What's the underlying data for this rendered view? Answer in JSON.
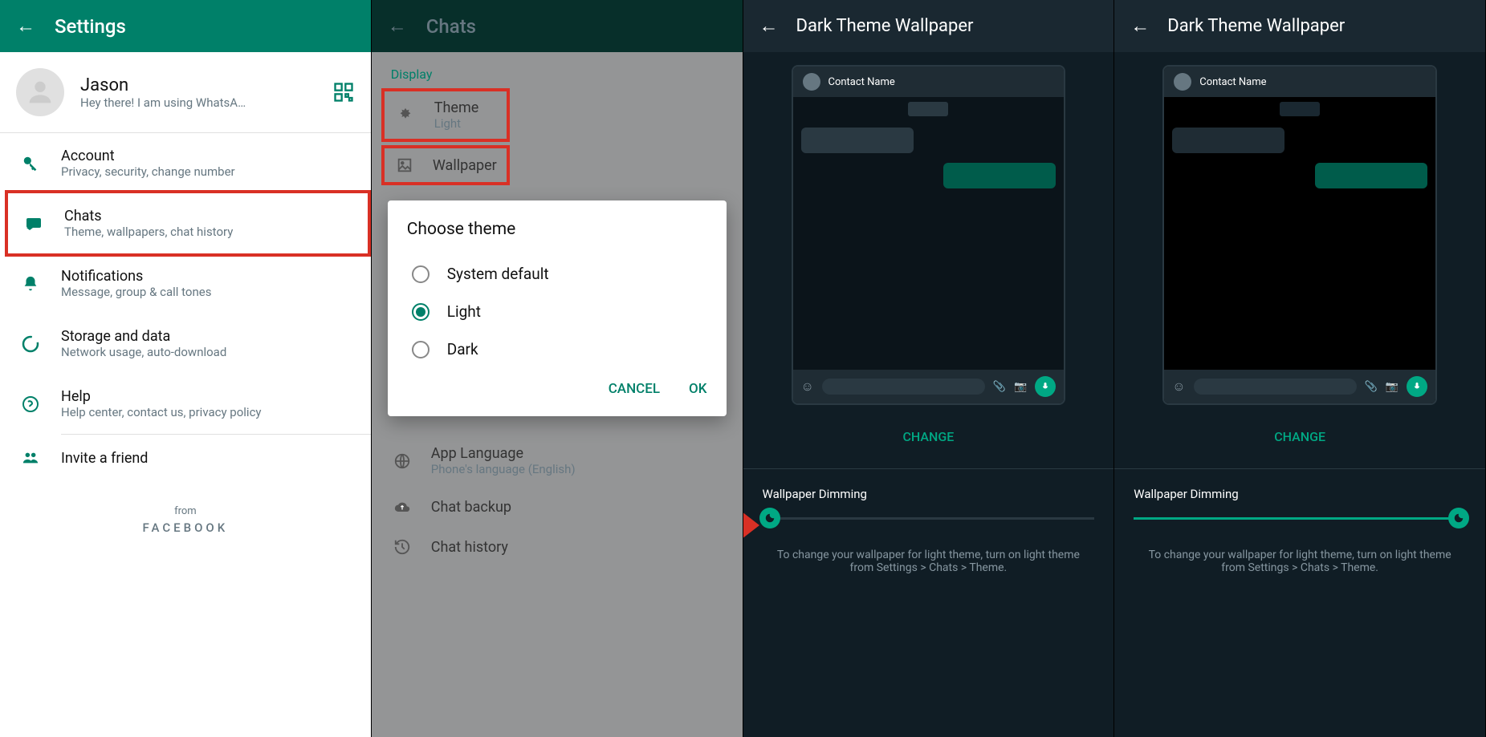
{
  "panel1": {
    "title": "Settings",
    "profile": {
      "name": "Jason",
      "status": "Hey there! I am using WhatsA…"
    },
    "items": [
      {
        "label": "Account",
        "sub": "Privacy, security, change number"
      },
      {
        "label": "Chats",
        "sub": "Theme, wallpapers, chat history"
      },
      {
        "label": "Notifications",
        "sub": "Message, group & call tones"
      },
      {
        "label": "Storage and data",
        "sub": "Network usage, auto-download"
      },
      {
        "label": "Help",
        "sub": "Help center, contact us, privacy policy"
      },
      {
        "label": "Invite a friend",
        "sub": ""
      }
    ],
    "footer": {
      "from": "from",
      "brand": "FACEBOOK"
    }
  },
  "panel2": {
    "title": "Chats",
    "section": "Display",
    "theme": {
      "label": "Theme",
      "value": "Light"
    },
    "wallpaper": "Wallpaper",
    "dialog": {
      "title": "Choose theme",
      "options": [
        "System default",
        "Light",
        "Dark"
      ],
      "selected": "Light",
      "cancel": "CANCEL",
      "ok": "OK"
    },
    "bottom": [
      {
        "label": "App Language",
        "sub": "Phone's language (English)"
      },
      {
        "label": "Chat backup",
        "sub": ""
      },
      {
        "label": "Chat history",
        "sub": ""
      }
    ]
  },
  "panel3": {
    "title": "Dark Theme Wallpaper",
    "contact": "Contact Name",
    "change": "CHANGE",
    "dim_label": "Wallpaper Dimming",
    "slider_pct": 0,
    "hint": "To change your wallpaper for light theme, turn on light theme from Settings > Chats > Theme."
  },
  "panel4": {
    "title": "Dark Theme Wallpaper",
    "contact": "Contact Name",
    "change": "CHANGE",
    "dim_label": "Wallpaper Dimming",
    "slider_pct": 100,
    "hint": "To change your wallpaper for light theme, turn on light theme from Settings > Chats > Theme."
  }
}
